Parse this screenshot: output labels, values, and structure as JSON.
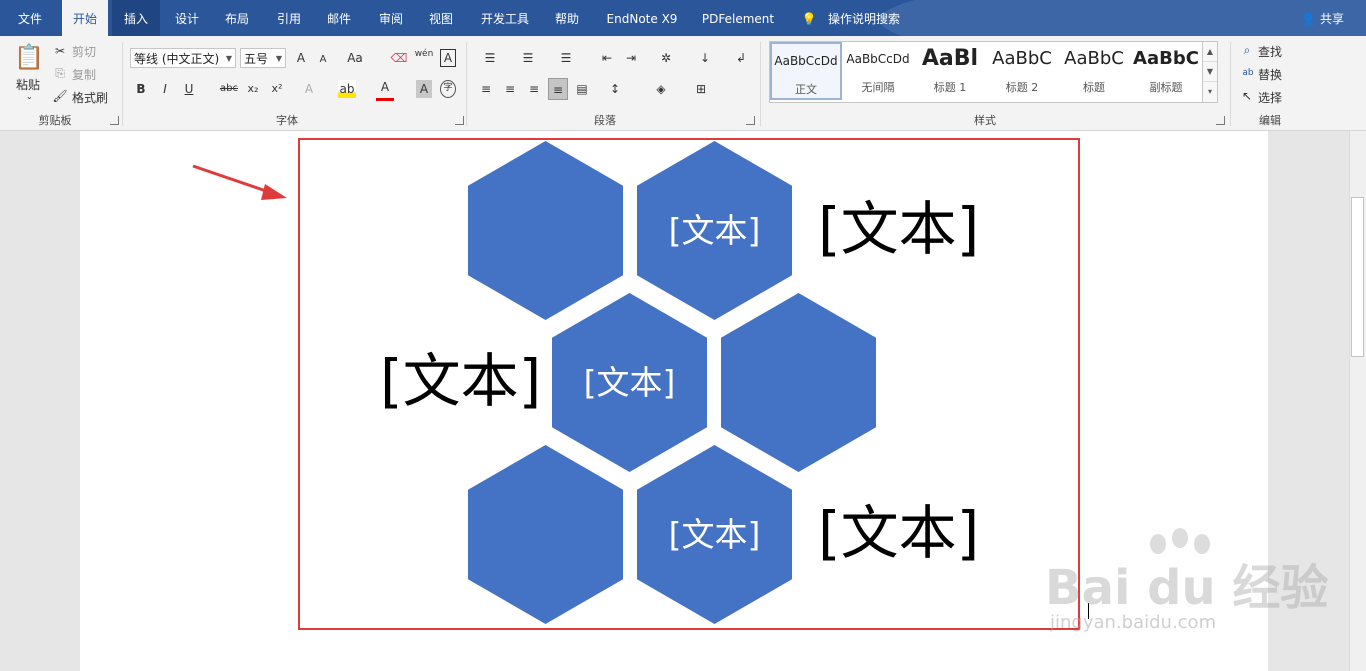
{
  "tabs": [
    {
      "id": "file",
      "label": "文件"
    },
    {
      "id": "home",
      "label": "开始"
    },
    {
      "id": "insert",
      "label": "插入"
    },
    {
      "id": "design",
      "label": "设计"
    },
    {
      "id": "layout",
      "label": "布局"
    },
    {
      "id": "references",
      "label": "引用"
    },
    {
      "id": "mailings",
      "label": "邮件"
    },
    {
      "id": "review",
      "label": "审阅"
    },
    {
      "id": "view",
      "label": "视图"
    },
    {
      "id": "developer",
      "label": "开发工具"
    },
    {
      "id": "help",
      "label": "帮助"
    },
    {
      "id": "endnote",
      "label": "EndNote X9"
    },
    {
      "id": "pdfelement",
      "label": "PDFelement"
    },
    {
      "id": "tellme",
      "label": "操作说明搜索"
    }
  ],
  "share_label": "共享",
  "clipboard": {
    "paste": "粘贴",
    "cut": "剪切",
    "copy": "复制",
    "format_painter": "格式刷",
    "group": "剪贴板"
  },
  "font": {
    "name": "等线 (中文正文)",
    "size": "五号",
    "group": "字体",
    "case": "Aa",
    "phonetic": "wén",
    "bold": "B",
    "italic": "I",
    "underline": "U",
    "strike": "abc",
    "sub": "x₂",
    "sup": "x²",
    "grow": "A",
    "shrink": "A",
    "effects": "A",
    "color_a": "A",
    "shade_a": "A",
    "enclose": "字"
  },
  "paragraph": {
    "group": "段落"
  },
  "styles": {
    "group": "样式",
    "items": [
      {
        "sample": "AaBbCcDd",
        "name": "正文"
      },
      {
        "sample": "AaBbCcDd",
        "name": "无间隔"
      },
      {
        "sample": "AaBl",
        "name": "标题 1"
      },
      {
        "sample": "AaBbC",
        "name": "标题 2"
      },
      {
        "sample": "AaBbC",
        "name": "标题"
      },
      {
        "sample": "AaBbC",
        "name": "副标题"
      }
    ]
  },
  "editing": {
    "find": "查找",
    "replace": "替换",
    "select": "选择",
    "group": "编辑"
  },
  "diagram": {
    "hex_texts": [
      "[文本]",
      "[文本]",
      "[文本]"
    ],
    "side_texts": [
      "[文本]",
      "[文本]",
      "[文本]"
    ]
  },
  "watermark": {
    "main": "Bai du 经验",
    "sub": "jingyan.baidu.com"
  },
  "colors": {
    "accent": "#2b579a",
    "hex_fill": "#4472c4",
    "frame": "#e03b3b"
  }
}
